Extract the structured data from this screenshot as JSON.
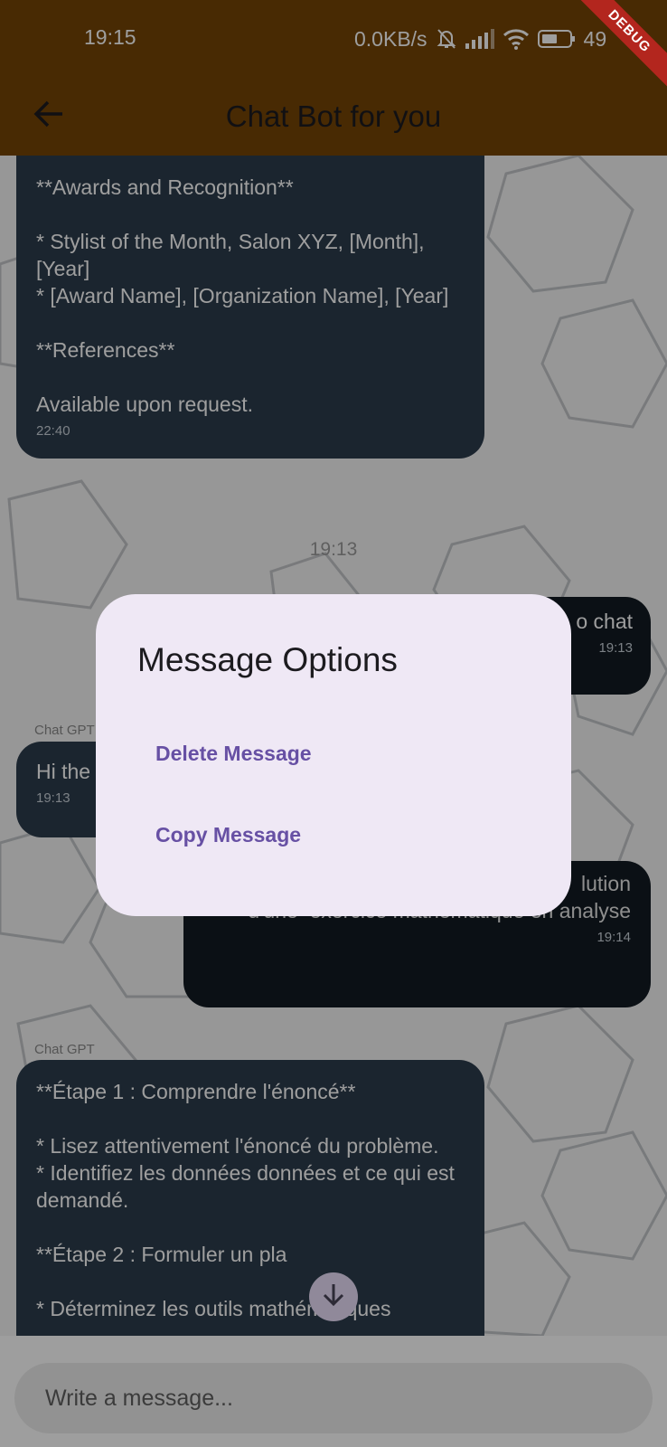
{
  "status_bar": {
    "time": "19:15",
    "network_speed": "0.0KB/s",
    "battery": "49",
    "icons": [
      "bell-off-icon",
      "signal-icon",
      "wifi-icon",
      "battery-icon"
    ]
  },
  "debug_banner": "DEBUG",
  "app_bar": {
    "title": "Chat Bot for you",
    "back_icon": "arrow-left-icon",
    "background": "#744506"
  },
  "messages": [
    {
      "sender": "",
      "role": "bot",
      "text": "**Awards and Recognition**\n\n* Stylist of the Month, Salon XYZ, [Month], [Year]\n* [Award Name], [Organization Name], [Year]\n\n**References**\n\nAvailable upon request.",
      "time": "22:40"
    },
    {
      "role": "date",
      "text": "19:13"
    },
    {
      "role": "user",
      "text": "o chat",
      "time": "19:13"
    },
    {
      "sender": "Chat GPT",
      "role": "bot",
      "text": "Hi the",
      "time": "19:13"
    },
    {
      "role": "user",
      "text": "lution\nd'une  exercice mathématique en analyse",
      "time": "19:14"
    },
    {
      "sender": "Chat GPT",
      "role": "bot",
      "text": "**Étape 1 : Comprendre l'énoncé**\n\n* Lisez attentivement l'énoncé du problème.\n* Identifiez les données données et ce qui est demandé.\n\n**Étape 2 : Formuler un pla\n\n* Déterminez les outils mathématiques",
      "time": ""
    }
  ],
  "scroll_down_icon": "arrow-down-icon",
  "input": {
    "placeholder": "Write a message...",
    "value": ""
  },
  "dialog": {
    "title": "Message Options",
    "actions": [
      {
        "label": "Delete Message"
      },
      {
        "label": "Copy Message"
      }
    ],
    "accent": "#6750a4",
    "background": "#efe8f5"
  },
  "colors": {
    "bot_bubble": "#2d3d4d",
    "user_bubble": "#121b22"
  }
}
